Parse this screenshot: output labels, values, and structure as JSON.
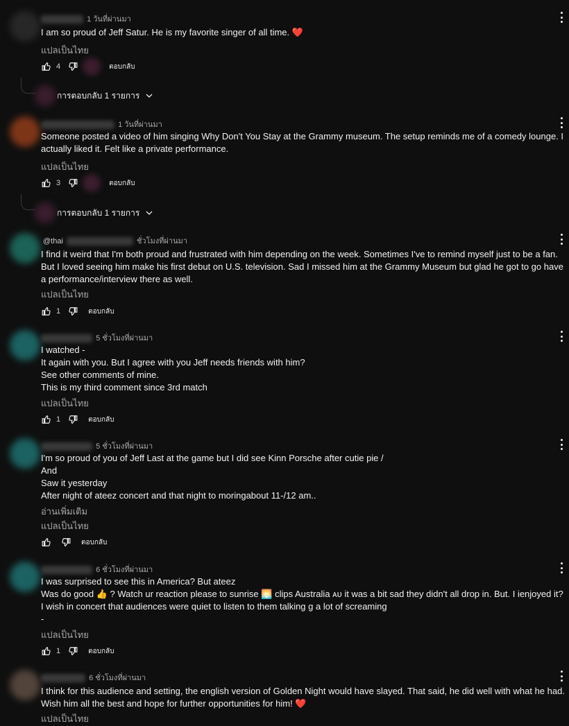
{
  "labels": {
    "translate": "แปลเป็นไทย",
    "reply": "ตอบกลับ",
    "read_more": "อ่านเพิ่มเติม",
    "replies_toggle": "การตอบกลับ 1 รายการ"
  },
  "comments": [
    {
      "handle": "",
      "time": "1 วันที่ผ่านมา",
      "text": "I am so proud of Jeff Satur. He is my favorite singer of all time. ❤️",
      "likes": "4",
      "avatar_color": "#2a2a2a"
    },
    {
      "handle": "",
      "time": "1 วันที่ผ่านมา",
      "text": "Someone posted a video of him singing Why Don't You Stay at the Grammy museum. The setup reminds me of a comedy lounge. I actually liked it. Felt like a private performance.",
      "likes": "3",
      "avatar_color": "#8a3a1a"
    },
    {
      "handle": "@thai",
      "time": "ชั่วโมงที่ผ่านมา",
      "text": "I find it weird that I'm both proud and frustrated with him depending on the week.  Sometimes I've to remind myself just to be a fan.  But I loved seeing him make his first debut on U.S. television.  Sad I missed him at the Grammy Museum but glad he got to go have a performance/interview there as well.",
      "likes": "1",
      "avatar_color": "#1e6b5e"
    },
    {
      "handle": "",
      "time": "5 ชั่วโมงที่ผ่านมา",
      "text": "I watched -\n It again with you. But I agree with you  Jeff needs friends with him?\n See other comments of mine.\nThis is my third comment  since 3rd match",
      "likes": "1",
      "avatar_color": "#1e6b6b"
    },
    {
      "handle": "",
      "time": "5 ชั่วโมงที่ผ่านมา",
      "text": "I'm so proud of you of Jeff   Last at the game but I did see Kinn Porsche after cutie pie  /\n And\n Saw it yesterday\nAfter night of ateez concert  and that night to moringabout 11-/12 am..",
      "likes": "",
      "avatar_color": "#1e6b6b"
    },
    {
      "handle": "",
      "time": "6 ชั่วโมงที่ผ่านมา",
      "text": "I was surprised to see this in America?  But ateez\nWas do good 👍 ? Watch ur reaction please to  sunrise 🌅 clips  Australia ᴀᴜ it was a bit sad they didn't all drop in. But. I ienjoyed it?\n I wish in concert that audiences were quiet to listen to them talking g  a lot of screaming\n-",
      "likes": "1",
      "avatar_color": "#1e6b6b"
    },
    {
      "handle": "",
      "time": "6 ชั่วโมงที่ผ่านมา",
      "text": "I think for this audience and setting, the english version of Golden Night would have slayed. That said, he did well with what he had. Wish him all the best and hope for further opportunities for him! ❤️",
      "likes": "",
      "avatar_color": "#5a4a40"
    }
  ],
  "icons": {
    "like": "thumbs-up-icon",
    "dislike": "thumbs-down-icon",
    "menu": "more-vert-icon",
    "chevron": "chevron-down-icon"
  }
}
